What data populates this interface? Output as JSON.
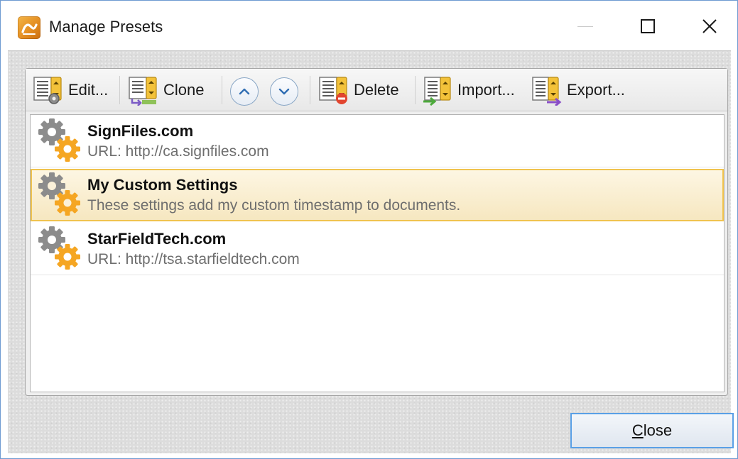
{
  "window": {
    "title": "Manage Presets"
  },
  "toolbar": {
    "edit_label": "Edit...",
    "clone_label": "Clone",
    "delete_label": "Delete",
    "import_label": "Import...",
    "export_label": "Export..."
  },
  "presets": [
    {
      "name": "SignFiles.com",
      "description": "URL: http://ca.signfiles.com",
      "selected": false
    },
    {
      "name": "My Custom Settings",
      "description": "These settings add my custom timestamp to documents.",
      "selected": true
    },
    {
      "name": "StarFieldTech.com",
      "description": "URL: http://tsa.starfieldtech.com",
      "selected": false
    }
  ],
  "footer": {
    "close_first": "C",
    "close_rest": "lose"
  },
  "colors": {
    "accent": "#5aa0e6",
    "selection_border": "#f0c34e",
    "gear_gray": "#8c8c8c",
    "gear_orange": "#f5a623"
  },
  "icons": [
    "app-logo-icon",
    "minimize-icon",
    "maximize-icon",
    "close-icon",
    "preset-edit-icon",
    "preset-clone-icon",
    "move-up-icon",
    "move-down-icon",
    "preset-delete-icon",
    "preset-import-icon",
    "preset-export-icon",
    "gear-pair-icon"
  ]
}
